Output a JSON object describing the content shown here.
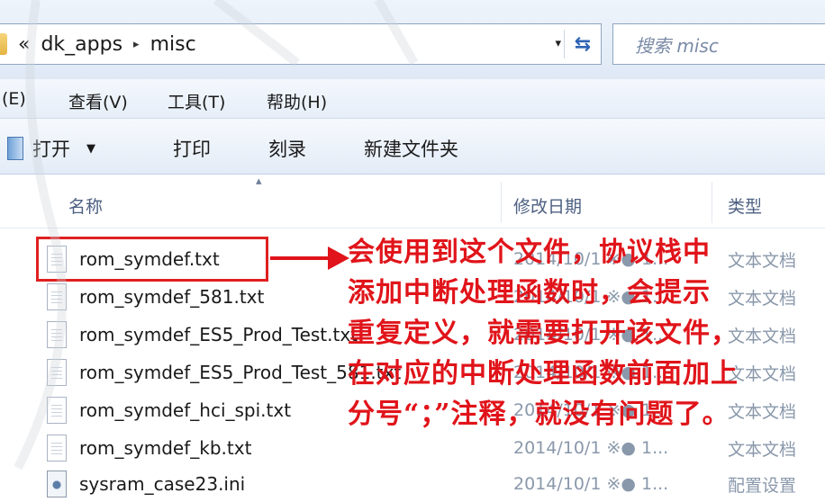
{
  "address_bar": {
    "breadcrumb_prefix": "«",
    "breadcrumb_parent": "dk_apps",
    "separator": "▸",
    "breadcrumb_current": "misc",
    "dropdown_glyph": "▾",
    "refresh_glyph": "⇆",
    "search_placeholder": "搜索 misc"
  },
  "menu_bar": {
    "items": [
      "(E)",
      "查看(V)",
      "工具(T)",
      "帮助(H)"
    ]
  },
  "toolbar": {
    "open_label": "打开",
    "open_caret": "▼",
    "print_label": "打印",
    "burn_label": "刻录",
    "new_folder_label": "新建文件夹"
  },
  "columns": {
    "name": "名称",
    "modified": "修改日期",
    "type": "类型"
  },
  "files": [
    {
      "name": "rom_symdef.txt",
      "date": "2014/10/1 ※● 1...",
      "type": "文本文档",
      "icon": "text-file-icon"
    },
    {
      "name": "rom_symdef_581.txt",
      "date": "2014/10/1 ※● 1...",
      "type": "文本文档",
      "icon": "text-file-icon"
    },
    {
      "name": "rom_symdef_ES5_Prod_Test.txt",
      "date": "2014/10/1 ※● 1...",
      "type": "文本文档",
      "icon": "text-file-icon"
    },
    {
      "name": "rom_symdef_ES5_Prod_Test_581.txt",
      "date": "2014/10/1 ※● 1...",
      "type": "文本文档",
      "icon": "text-file-icon"
    },
    {
      "name": "rom_symdef_hci_spi.txt",
      "date": "2014/10/1 ※● 1...",
      "type": "文本文档",
      "icon": "text-file-icon"
    },
    {
      "name": "rom_symdef_kb.txt",
      "date": "2014/10/1 ※● 1...",
      "type": "文本文档",
      "icon": "text-file-icon"
    },
    {
      "name": "sysram_case23.ini",
      "date": "2014/10/1 ※● 1...",
      "type": "配置设置",
      "icon": "config-file-icon"
    }
  ],
  "annotation": {
    "line1": "会使用到这个文件，协议栈中",
    "line2": "添加中断处理函数时，会提示",
    "line3": "重复定义，就需要打开该文件，",
    "line4": "在对应的中断处理函数前面加上",
    "line5": "分号“；”注释，就没有问题了。"
  },
  "colors": {
    "annotation_red": "#e0141a",
    "highlight_red": "#e02020",
    "header_text": "#4d6082"
  }
}
